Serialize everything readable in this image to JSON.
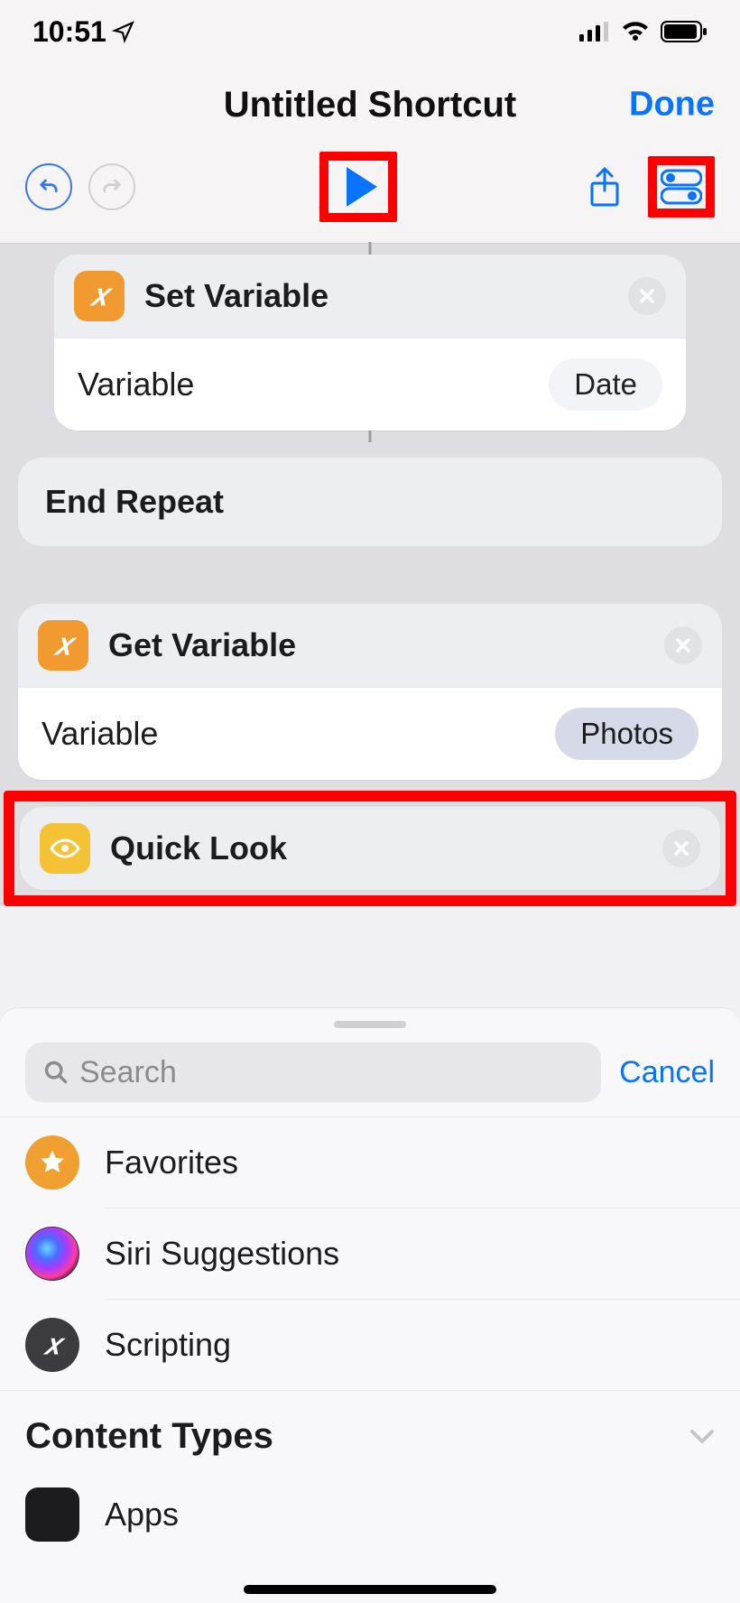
{
  "status": {
    "time": "10:51"
  },
  "nav": {
    "title": "Untitled Shortcut",
    "done": "Done"
  },
  "actions": {
    "setVar": {
      "title": "Set Variable",
      "paramLabel": "Variable",
      "paramValue": "Date"
    },
    "endRepeat": {
      "title": "End Repeat"
    },
    "getVar": {
      "title": "Get Variable",
      "paramLabel": "Variable",
      "paramValue": "Photos"
    },
    "quickLook": {
      "title": "Quick Look"
    }
  },
  "search": {
    "placeholder": "Search",
    "cancel": "Cancel"
  },
  "categories": {
    "favorites": "Favorites",
    "siri": "Siri Suggestions",
    "scripting": "Scripting",
    "contentTypes": "Content Types",
    "apps": "Apps"
  }
}
